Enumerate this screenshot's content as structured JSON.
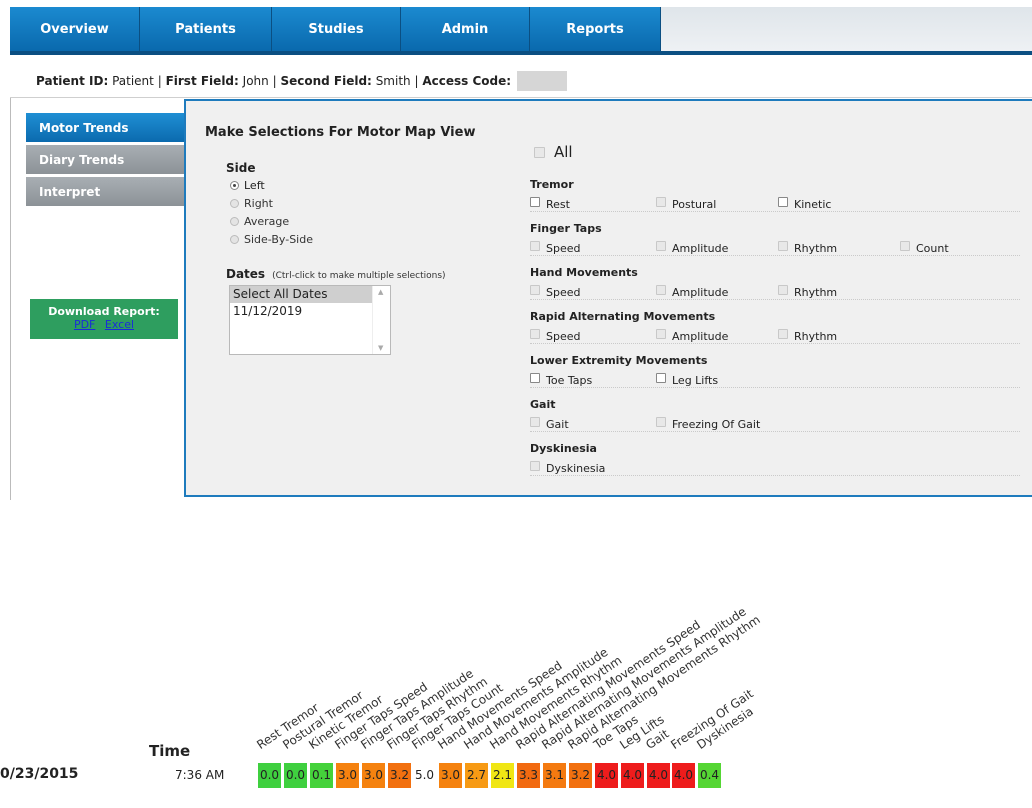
{
  "nav": {
    "tabs": [
      {
        "label": "Overview"
      },
      {
        "label": "Patients"
      },
      {
        "label": "Studies"
      },
      {
        "label": "Admin"
      },
      {
        "label": "Reports"
      }
    ]
  },
  "patient": {
    "id_label": "Patient ID:",
    "id_value": "Patient",
    "first_label": "First Field:",
    "first_value": "John",
    "second_label": "Second Field:",
    "second_value": "Smith",
    "access_label": "Access Code:",
    "sep": "|"
  },
  "sidebar": {
    "items": [
      {
        "label": "Motor Trends",
        "active": true
      },
      {
        "label": "Diary Trends",
        "active": false
      },
      {
        "label": "Interpret",
        "active": false
      }
    ],
    "download": {
      "label": "Download Report:",
      "pdf": "PDF",
      "excel": "Excel"
    }
  },
  "panel": {
    "title": "Make Selections For Motor Map View",
    "side_heading": "Side",
    "side_options": [
      {
        "label": "Left",
        "checked": true
      },
      {
        "label": "Right",
        "checked": false
      },
      {
        "label": "Average",
        "checked": false
      },
      {
        "label": "Side-By-Side",
        "checked": false
      }
    ],
    "dates_heading": "Dates",
    "dates_hint": "(Ctrl-click to make multiple selections)",
    "dates": [
      "Select All Dates",
      "11/12/2019"
    ],
    "all_label": "All",
    "groups": [
      {
        "heading": "Tremor",
        "options": [
          "Rest",
          "Postural",
          "Kinetic"
        ]
      },
      {
        "heading": "Finger Taps",
        "options": [
          "Speed",
          "Amplitude",
          "Rhythm",
          "Count"
        ]
      },
      {
        "heading": "Hand Movements",
        "options": [
          "Speed",
          "Amplitude",
          "Rhythm"
        ]
      },
      {
        "heading": "Rapid Alternating Movements",
        "options": [
          "Speed",
          "Amplitude",
          "Rhythm"
        ]
      },
      {
        "heading": "Lower Extremity Movements",
        "options": [
          "Toe Taps",
          "Leg Lifts"
        ]
      },
      {
        "heading": "Gait",
        "options": [
          "Gait",
          "Freezing Of Gait"
        ]
      },
      {
        "heading": "Dyskinesia",
        "options": [
          "Dyskinesia"
        ]
      }
    ]
  },
  "heatmap": {
    "time_header": "Time",
    "date": "0/23/2015",
    "time": "7:36 AM",
    "columns": [
      {
        "label": "Rest Tremor",
        "value": "0.0",
        "color": "#3fd03f"
      },
      {
        "label": "Postural Tremor",
        "value": "0.0",
        "color": "#3fd03f"
      },
      {
        "label": "Kinetic Tremor",
        "value": "0.1",
        "color": "#45d23b"
      },
      {
        "label": "Finger Taps Speed",
        "value": "3.0",
        "color": "#f5820f"
      },
      {
        "label": "Finger Taps Amplitude",
        "value": "3.0",
        "color": "#f5820f"
      },
      {
        "label": "Finger Taps Rhythm",
        "value": "3.2",
        "color": "#f2700f"
      },
      {
        "label": "Finger Taps Count",
        "value": "5.0",
        "color": "#ffffff"
      },
      {
        "label": "Hand Movements Speed",
        "value": "3.0",
        "color": "#f5820f"
      },
      {
        "label": "Hand Movements Amplitude",
        "value": "2.7",
        "color": "#f79a14"
      },
      {
        "label": "Hand Movements Rhythm",
        "value": "2.1",
        "color": "#f0e614"
      },
      {
        "label": "Rapid Alternating Movements Speed",
        "value": "3.3",
        "color": "#f26a10"
      },
      {
        "label": "Rapid Alternating Movements Amplitude",
        "value": "3.1",
        "color": "#f47a10"
      },
      {
        "label": "Rapid Alternating Movements Rhythm",
        "value": "3.2",
        "color": "#f2700f"
      },
      {
        "label": "Toe Taps",
        "value": "4.0",
        "color": "#ee1c1c"
      },
      {
        "label": "Leg Lifts",
        "value": "4.0",
        "color": "#ee1c1c"
      },
      {
        "label": "Gait",
        "value": "4.0",
        "color": "#ee1c1c"
      },
      {
        "label": "Freezing Of Gait",
        "value": "4.0",
        "color": "#ee1c1c"
      },
      {
        "label": "Dyskinesia",
        "value": "0.4",
        "color": "#55d634"
      }
    ]
  }
}
